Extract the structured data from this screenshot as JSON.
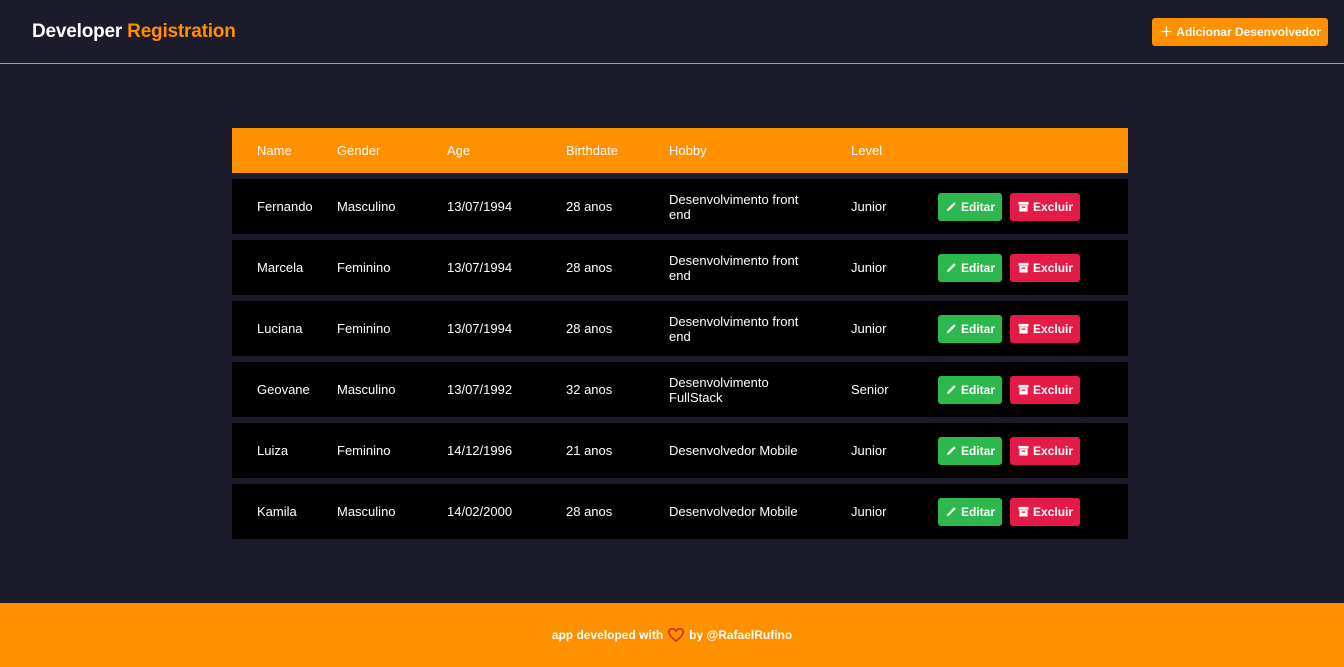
{
  "header": {
    "brand_main": "Developer",
    "brand_accent": "Registration",
    "add_button_label": "Adicionar Desenvolvedor"
  },
  "table": {
    "columns": [
      "Name",
      "Gender",
      "Age",
      "Birthdate",
      "Hobby",
      "Level"
    ],
    "rows": [
      {
        "name": "Fernando",
        "gender": "Masculino",
        "age": "13/07/1994",
        "birthdate": "28 anos",
        "hobby": "Desenvolvimento front end",
        "level": "Junior"
      },
      {
        "name": "Marcela",
        "gender": "Feminino",
        "age": "13/07/1994",
        "birthdate": "28 anos",
        "hobby": "Desenvolvimento front end",
        "level": "Junior"
      },
      {
        "name": "Luciana",
        "gender": "Feminino",
        "age": "13/07/1994",
        "birthdate": "28 anos",
        "hobby": "Desenvolvimento front end",
        "level": "Junior"
      },
      {
        "name": "Geovane",
        "gender": "Masculino",
        "age": "13/07/1992",
        "birthdate": "32 anos",
        "hobby": "Desenvolvimento FullStack",
        "level": "Senior"
      },
      {
        "name": "Luiza",
        "gender": "Feminino",
        "age": "14/12/1996",
        "birthdate": "21 anos",
        "hobby": "Desenvolvedor Mobile",
        "level": "Junior"
      },
      {
        "name": "Kamila",
        "gender": "Masculino",
        "age": "14/02/2000",
        "birthdate": "28 anos",
        "hobby": "Desenvolvedor Mobile",
        "level": "Junior"
      }
    ],
    "edit_label": "Editar",
    "delete_label": "Excluir"
  },
  "footer": {
    "text_before": "app developed with",
    "text_after": "by @RafaelRufino"
  },
  "icons": {
    "add": "plus-icon",
    "edit": "pencil-icon",
    "delete": "trash-icon",
    "heart": "heart-icon"
  },
  "colors": {
    "accent": "#ff9000",
    "background": "#1c1b2b",
    "row": "#000000",
    "edit": "#2db84d",
    "delete": "#e41b46"
  }
}
